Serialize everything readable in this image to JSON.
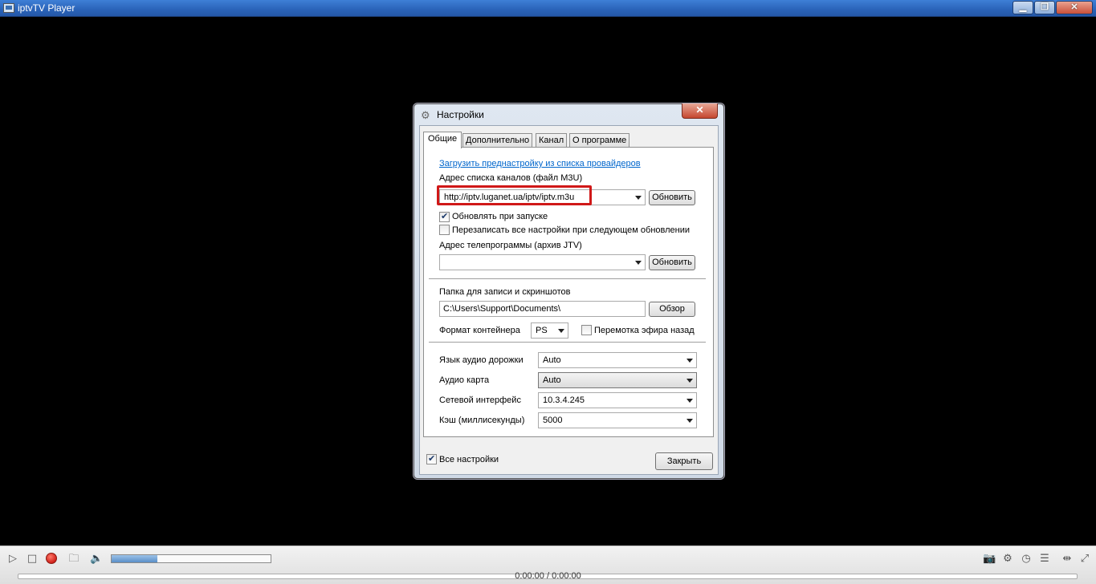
{
  "window": {
    "title": "iptvTV Player",
    "minimize": "▁",
    "maximize": "❐",
    "close": "✕"
  },
  "dialog": {
    "title": "Настройки",
    "close": "✕",
    "tabs": [
      "Общие",
      "Дополнительно",
      "Канал",
      "О программе"
    ],
    "general": {
      "provider_link": "Загрузить преднастройку из списка провайдеров",
      "playlist_label": "Адрес списка каналов (файл M3U)",
      "playlist_value": "http://iptv.luganet.ua/iptv/iptv.m3u",
      "update_button": "Обновить",
      "update_on_start_label": "Обновлять при запуске",
      "update_on_start_checked": true,
      "overwrite_label": "Перезаписать все настройки при следующем обновлении",
      "overwrite_checked": false,
      "epg_label": "Адрес телепрограммы (архив JTV)",
      "epg_value": "",
      "epg_update_button": "Обновить",
      "folder_label": "Папка для записи и скриншотов",
      "folder_value": "C:\\Users\\Support\\Documents\\",
      "browse_button": "Обзор",
      "container_label": "Формат контейнера",
      "container_value": "PS",
      "rewind_label": "Перемотка эфира назад",
      "rewind_checked": false,
      "audio_track_label": "Язык аудио дорожки",
      "audio_track_value": "Auto",
      "audio_card_label": "Аудио карта",
      "audio_card_value": "Auto",
      "network_label": "Сетевой интерфейс",
      "network_value": "10.3.4.245",
      "cache_label": "Кэш (миллисекунды)",
      "cache_value": "5000"
    },
    "all_settings_label": "Все настройки",
    "all_settings_checked": true,
    "close_button": "Закрыть"
  },
  "player": {
    "play_icon": "▷",
    "stop_icon": "□",
    "open_icon": "🗀",
    "volume_icon": "🔈",
    "volume_level": 0.29,
    "time": "0:00:00 / 0:00:00",
    "screenshot_icon": "📷",
    "settings_icon": "⚙",
    "epg_icon": "◷",
    "playlist_icon": "☰",
    "fit_icon": "⇹",
    "fullscreen_icon": "⤢"
  }
}
